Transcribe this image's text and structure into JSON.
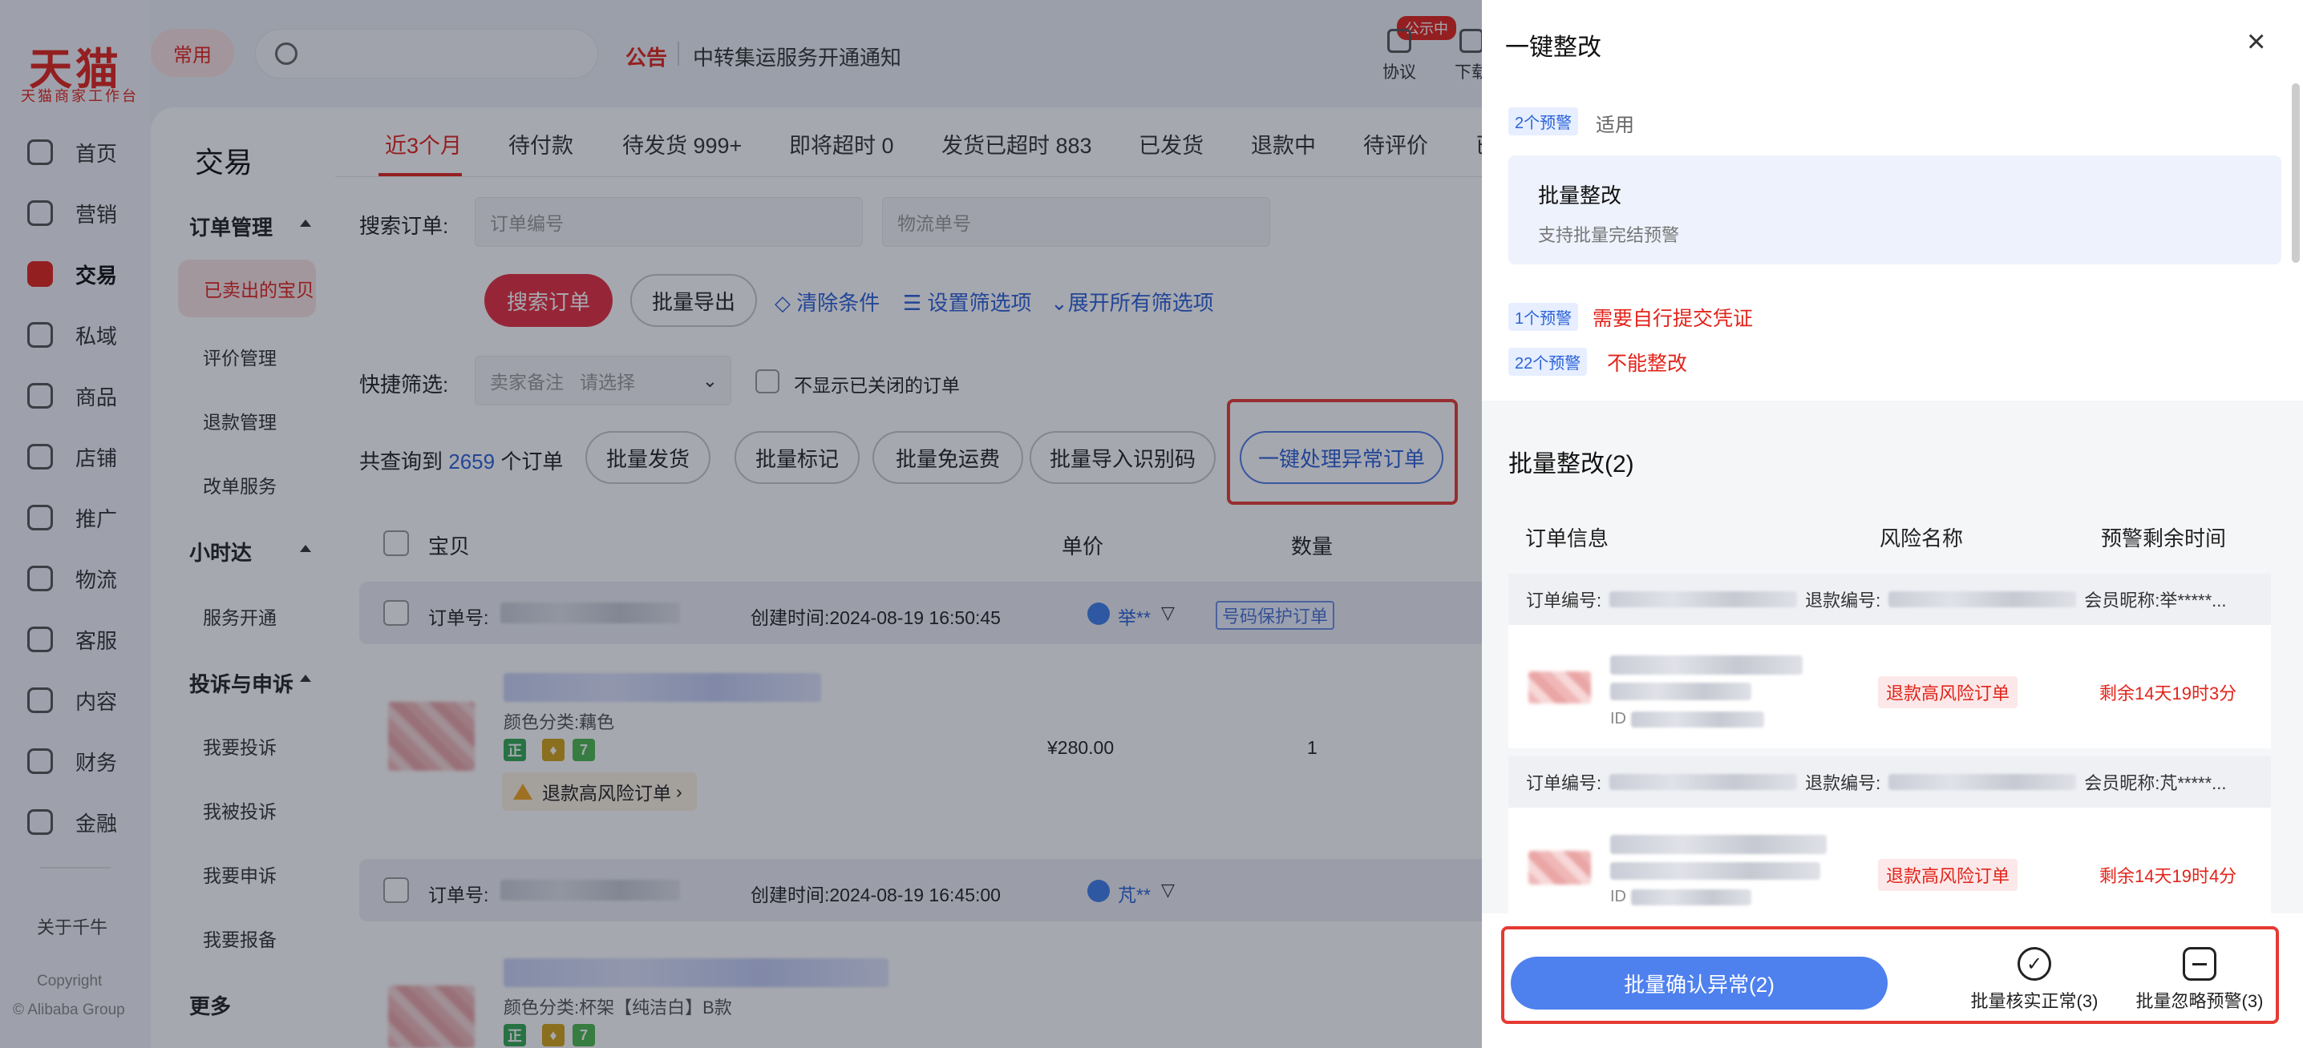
{
  "brand": {
    "logo": "天猫",
    "sub": "天猫商家工作台"
  },
  "nav": {
    "items": [
      {
        "label": "首页",
        "icon": "home-icon"
      },
      {
        "label": "营销",
        "icon": "megaphone-icon"
      },
      {
        "label": "交易",
        "icon": "trade-icon",
        "active": true
      },
      {
        "label": "私域",
        "icon": "users-icon"
      },
      {
        "label": "商品",
        "icon": "goods-icon"
      },
      {
        "label": "店铺",
        "icon": "shop-icon"
      },
      {
        "label": "推广",
        "icon": "promote-icon"
      },
      {
        "label": "物流",
        "icon": "truck-icon"
      },
      {
        "label": "客服",
        "icon": "headset-icon"
      },
      {
        "label": "内容",
        "icon": "content-icon"
      },
      {
        "label": "财务",
        "icon": "yuan-icon"
      },
      {
        "label": "金融",
        "icon": "finance-icon"
      }
    ],
    "about": "关于千牛",
    "copyright": "Copyright",
    "company": "© Alibaba Group"
  },
  "header": {
    "common": "常用",
    "notice_tag": "公告",
    "notice_text": "中转集运服务开通通知",
    "agreement": "协议",
    "download": "下载",
    "badge": "公示中"
  },
  "side2": {
    "title": "交易",
    "groups": [
      {
        "title": "订单管理",
        "items": [
          "已卖出的宝贝",
          "评价管理",
          "退款管理",
          "改单服务"
        ]
      },
      {
        "title": "小时达",
        "items": [
          "服务开通"
        ]
      },
      {
        "title": "投诉与申诉",
        "items": [
          "我要投诉",
          "我被投诉",
          "我要申诉",
          "我要报备"
        ]
      }
    ],
    "more": "更多"
  },
  "tabs": [
    "近3个月",
    "待付款",
    "待发货 999+",
    "即将超时 0",
    "发货已超时 883",
    "已发货",
    "退款中",
    "待评价",
    "已"
  ],
  "search": {
    "label": "搜索订单:",
    "order_placeholder": "订单编号",
    "logistics_placeholder": "物流单号",
    "btn": "搜索订单",
    "export": "批量导出",
    "clear": "清除条件",
    "filter": "设置筛选项",
    "expand": "展开所有筛选项"
  },
  "quick": {
    "label": "快捷筛选:",
    "remark": "卖家备注",
    "select": "请选择",
    "hide_closed": "不显示已关闭的订单"
  },
  "summary": {
    "prefix": "共查询到",
    "count": "2659",
    "suffix": "个订单",
    "actions": [
      "批量发货",
      "批量标记",
      "批量免运费",
      "批量导入识别码"
    ],
    "handle": "一键处理异常订单"
  },
  "table": {
    "cols": [
      "宝贝",
      "单价",
      "数量"
    ],
    "orders": [
      {
        "no_label": "订单号:",
        "created": "创建时间:2024-08-19 16:50:45",
        "buyer": "举**",
        "protect": "号码保护订单",
        "sku": "颜色分类:藕色",
        "price": "¥280.00",
        "qty": "1",
        "risk": "退款高风险订单"
      },
      {
        "no_label": "订单号:",
        "created": "创建时间:2024-08-19 16:45:00",
        "buyer": "芃**",
        "sku": "颜色分类:杯架【纯洁白】B款"
      }
    ]
  },
  "drawer": {
    "title": "一键整改",
    "s1": {
      "tag": "2个预警",
      "text": "适用"
    },
    "card": {
      "title": "批量整改",
      "sub": "支持批量完结预警"
    },
    "s2": {
      "tag": "1个预警",
      "text": "需要自行提交凭证"
    },
    "s3": {
      "tag": "22个预警",
      "text": "不能整改"
    },
    "section": "批量整改(2)",
    "cols": [
      "订单信息",
      "风险名称",
      "预警剩余时间"
    ],
    "rows": [
      {
        "order_label": "订单编号:",
        "refund_label": "退款编号:",
        "member": "会员昵称:举*****...",
        "id": "ID",
        "risk": "退款高风险订单",
        "remain": "剩余14天19时3分"
      },
      {
        "order_label": "订单编号:",
        "refund_label": "退款编号:",
        "member": "会员昵称:芃*****...",
        "id": "ID",
        "risk": "退款高风险订单",
        "remain": "剩余14天19时4分"
      }
    ],
    "confirm": "批量确认异常(2)",
    "verify": "批量核实正常(3)",
    "ignore": "批量忽略预警(3)"
  }
}
